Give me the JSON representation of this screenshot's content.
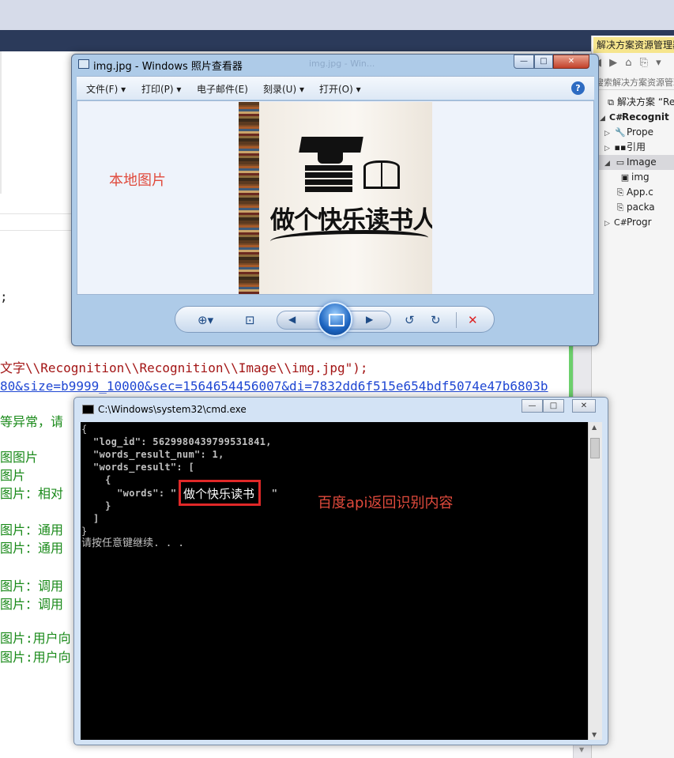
{
  "editor": {
    "code_lines": [
      {
        "text": ";",
        "class": "c-dark"
      },
      {
        "text": "文字\\\\Recognition\\\\Recognition\\\\Image\\\\img.jpg\");",
        "class": "c-red"
      },
      {
        "text": "80&size=b9999_10000&sec=1564654456007&di=7832dd6f515e654bdf5074e47b6803b",
        "class": "c-link"
      },
      {
        "text": "等异常，请",
        "class": "c-green"
      },
      {
        "text": "图图片",
        "class": "c-green"
      },
      {
        "text": "图片",
        "class": "c-green"
      },
      {
        "text": "图片：相对",
        "class": "c-green"
      },
      {
        "text": "图片：通用",
        "class": "c-green"
      },
      {
        "text": "图片：通用",
        "class": "c-green"
      },
      {
        "text": "图片：调用",
        "class": "c-green"
      },
      {
        "text": "图片：调用",
        "class": "c-green"
      },
      {
        "text": "图片:用户向",
        "class": "c-green"
      },
      {
        "text": "图片:用户向",
        "class": "c-green"
      }
    ]
  },
  "solution_explorer": {
    "header": "解决方案资源管理器",
    "toolbar_glyphs": "◀ ▶ ⌂ ⎘ ▾",
    "search_placeholder": "搜索解决方案资源管理器",
    "tree": [
      {
        "label": "解决方案 “Re",
        "icon": "⧉",
        "expander": "",
        "indent": 0
      },
      {
        "label": "Recognit",
        "icon": "C#",
        "expander": "◢",
        "indent": 1,
        "bold": true
      },
      {
        "label": "Prope",
        "icon": "🔧",
        "expander": "▷",
        "indent": 2
      },
      {
        "label": "引用",
        "icon": "▪▪",
        "expander": "▷",
        "indent": 2
      },
      {
        "label": "Image",
        "icon": "▭",
        "expander": "◢",
        "indent": 2,
        "selected": true
      },
      {
        "label": "img",
        "icon": "▣",
        "expander": "",
        "indent": 3
      },
      {
        "label": "App.c",
        "icon": "⎘",
        "expander": "",
        "indent": 2
      },
      {
        "label": "packa",
        "icon": "⎘",
        "expander": "",
        "indent": 2
      },
      {
        "label": "Progr",
        "icon": "C#",
        "expander": "▷",
        "indent": 2
      }
    ]
  },
  "photo_viewer": {
    "title": "img.jpg - Windows 照片查看器",
    "title_ghost": "img.jpg - Win...",
    "menu": [
      "文件(F) ▾",
      "打印(P) ▾",
      "电子邮件(E)",
      "刻录(U) ▾",
      "打开(O) ▾"
    ],
    "help_label": "?",
    "local_image_label": "本地图片",
    "image_text": "做个快乐读书人",
    "window_buttons": {
      "minimize": "—",
      "maximize": "□",
      "close": "✕"
    },
    "controls": {
      "zoom": "⊕▾",
      "fit": "⊡",
      "prev": "◀",
      "next": "▶",
      "rotate_ccw": "↺",
      "rotate_cw": "↻",
      "delete": "✕"
    }
  },
  "cmd": {
    "title": "C:\\Windows\\system32\\cmd.exe",
    "window_buttons": {
      "minimize": "—",
      "maximize": "□",
      "close": "✕"
    },
    "lines": [
      "{",
      "  \"log_id\": 5629980439799531841,",
      "  \"words_result_num\": 1,",
      "  \"words_result\": [",
      "    {",
      "      \"words\": \"                \"",
      "    }",
      "  ]",
      "}",
      "请按任意键继续. . ."
    ],
    "words_value": "做个快乐读书",
    "annotation": "百度api返回识别内容"
  }
}
